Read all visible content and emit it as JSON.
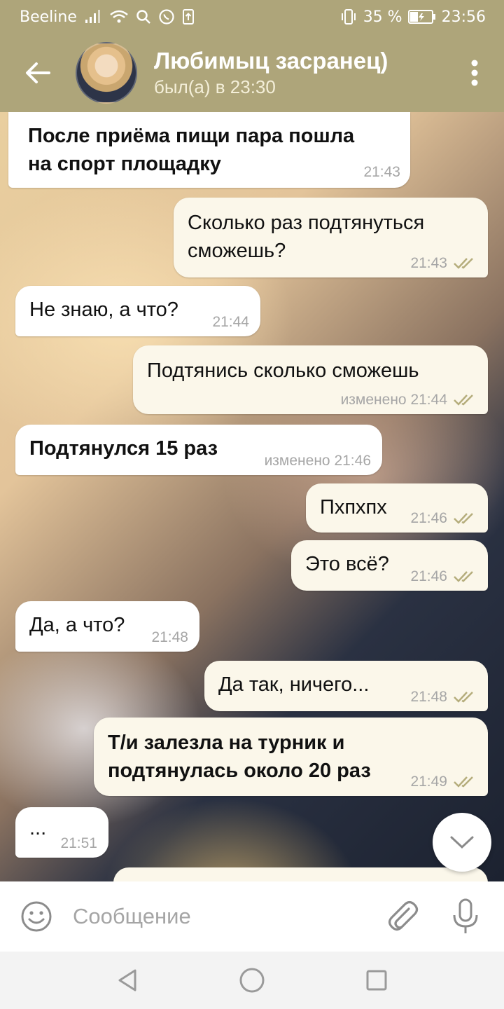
{
  "status_bar": {
    "carrier": "Beeline",
    "battery": "35 %",
    "time": "23:56",
    "icons": [
      "signal-icon",
      "wifi-icon",
      "search-icon",
      "whatsapp-icon",
      "upload-icon",
      "vibrate-icon",
      "battery-icon"
    ]
  },
  "header": {
    "title": "Любимыц засранец)",
    "status": "был(а) в 23:30",
    "color": "#aea57a"
  },
  "messages": [
    {
      "direction": "in",
      "text_line1": "После приёма пищи пара пошла",
      "text_line2": "на спорт площадку",
      "time": "21:43"
    },
    {
      "direction": "out",
      "text_line1": "Сколько раз подтянуться",
      "text_line2": "сможешь?",
      "time": "21:43"
    },
    {
      "direction": "in",
      "text": "Не знаю, а что?",
      "time": "21:44"
    },
    {
      "direction": "out",
      "text": "Подтянись сколько сможешь",
      "time": "изменено 21:44"
    },
    {
      "direction": "in",
      "text": "Подтянулся 15 раз",
      "time": "изменено 21:46"
    },
    {
      "direction": "out",
      "text": "Пхпхпх",
      "time": "21:46"
    },
    {
      "direction": "out",
      "text": "Это всё?",
      "time": "21:46"
    },
    {
      "direction": "in",
      "text": "Да, а что?",
      "time": "21:48"
    },
    {
      "direction": "out",
      "text": "Да так, ничего...",
      "time": "21:48"
    },
    {
      "direction": "out",
      "text_line1": "Т/и залезла на турник и",
      "text_line2": "подтянулась около 20 раз",
      "time": "21:49"
    },
    {
      "direction": "in",
      "text": "...",
      "time": "21:51"
    }
  ],
  "input": {
    "placeholder": "Сообщение"
  },
  "colors": {
    "accent": "#aea57a",
    "check": "#b5ad7c",
    "incoming_bubble": "#ffffff",
    "outgoing_bubble": "#fbf7ea"
  }
}
